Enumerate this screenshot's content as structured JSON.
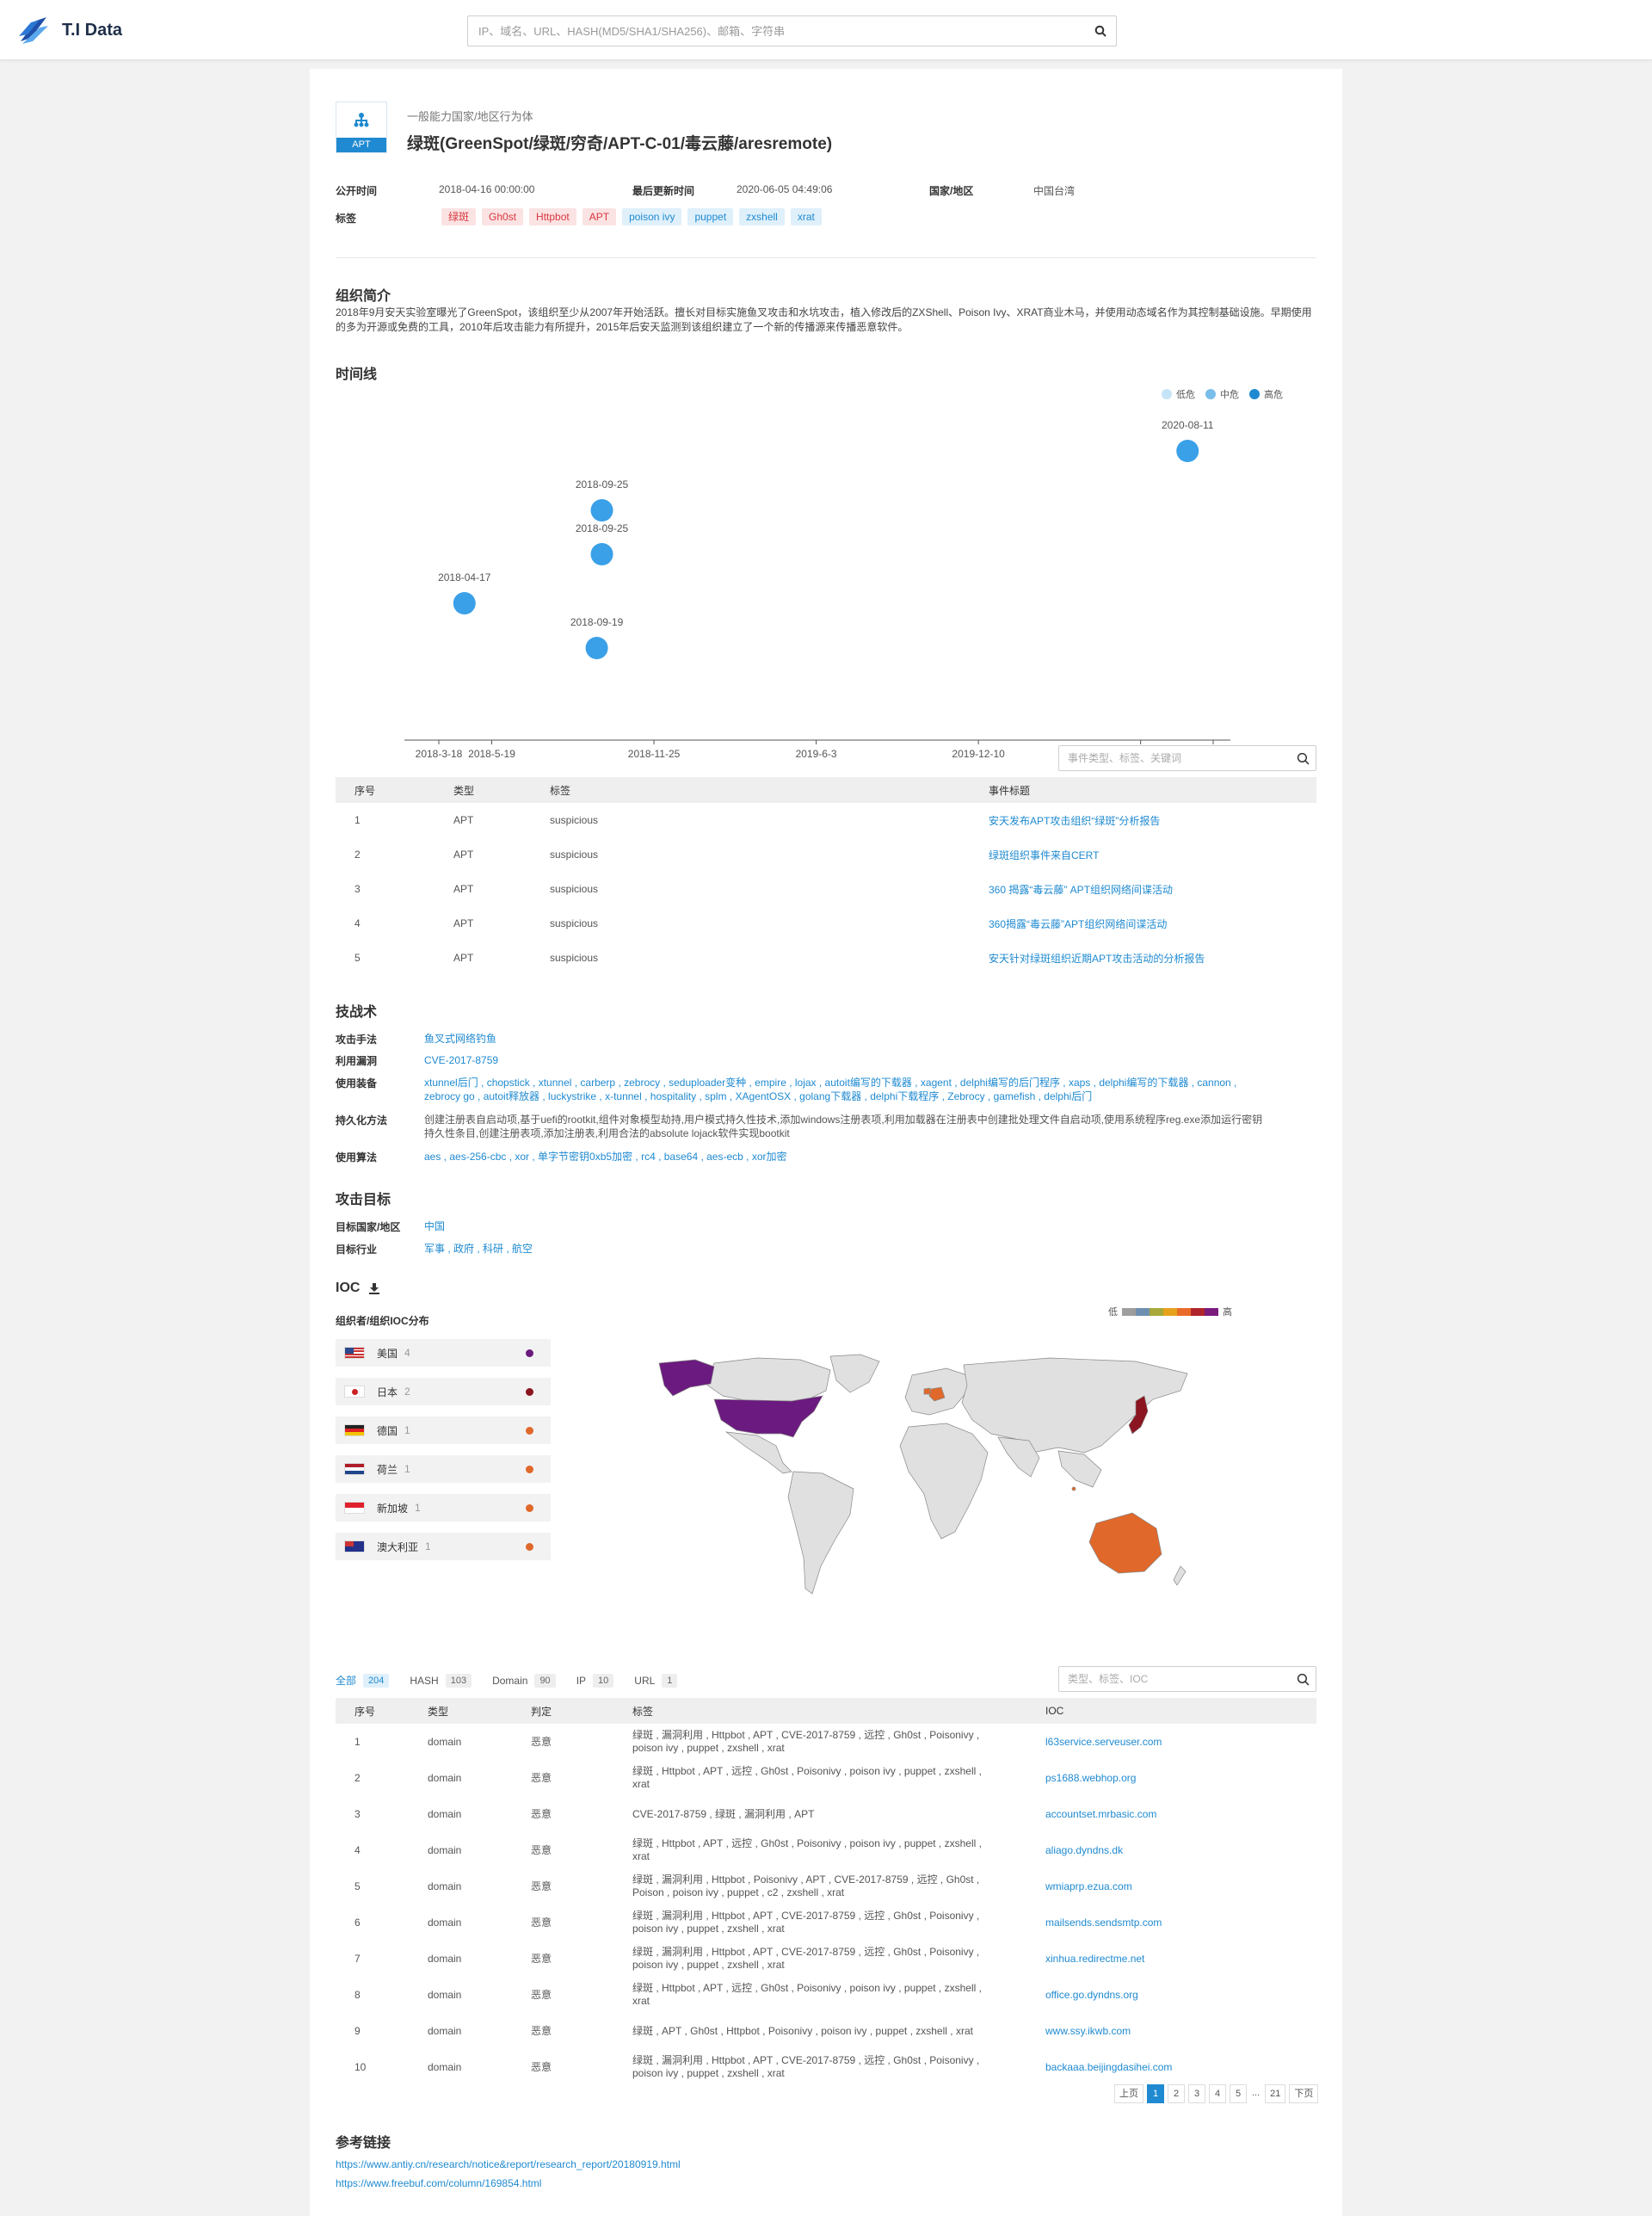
{
  "app": {
    "name": "T.I Data"
  },
  "search": {
    "placeholder": "IP、域名、URL、HASH(MD5/SHA1/SHA256)、邮箱、字符串"
  },
  "header": {
    "badge": "APT",
    "subtitle": "一般能力国家/地区行为体",
    "title": "绿斑(GreenSpot/绿斑/穷奇/APT-C-01/毒云藤/aresremote)"
  },
  "meta": {
    "published_label": "公开时间",
    "published": "2018-04-16 00:00:00",
    "updated_label": "最后更新时间",
    "updated": "2020-06-05 04:49:06",
    "country_label": "国家/地区",
    "country": "中国台湾",
    "tags_label": "标签",
    "tags": [
      {
        "text": "绿斑",
        "kind": "red"
      },
      {
        "text": "Gh0st",
        "kind": "red"
      },
      {
        "text": "Httpbot",
        "kind": "red"
      },
      {
        "text": "APT",
        "kind": "red"
      },
      {
        "text": "poison ivy",
        "kind": "blue"
      },
      {
        "text": "puppet",
        "kind": "blue"
      },
      {
        "text": "zxshell",
        "kind": "blue"
      },
      {
        "text": "xrat",
        "kind": "blue"
      }
    ]
  },
  "intro": {
    "title": "组织简介",
    "text": "2018年9月安天实验室曝光了GreenSpot，该组织至少从2007年开始活跃。擅长对目标实施鱼叉攻击和水坑攻击，植入修改后的ZXShell、Poison Ivy、XRAT商业木马，并使用动态域名作为其控制基础设施。早期使用的多为开源或免费的工具，2010年后攻击能力有所提升，2015年后安天监测到该组织建立了一个新的传播源来传播恶意软件。"
  },
  "timeline": {
    "title": "时间线",
    "legend": [
      {
        "label": "低危",
        "color": "#c6e4f7"
      },
      {
        "label": "中危",
        "color": "#79bdea"
      },
      {
        "label": "高危",
        "color": "#1f8ad1"
      }
    ]
  },
  "chart_data": {
    "type": "scatter",
    "x_ticks": [
      "2018-3-18",
      "2018-5-19",
      "2018-11-25",
      "2019-6-3",
      "2019-12-10",
      "2020-6-17",
      "2020-9-10"
    ],
    "points": [
      {
        "date": "2018-04-17",
        "label": "2018-04-17",
        "level": "高危"
      },
      {
        "date": "2018-09-25",
        "label": "2018-09-25",
        "level": "高危"
      },
      {
        "date": "2018-09-25",
        "label": "2018-09-25",
        "level": "高危"
      },
      {
        "date": "2018-09-19",
        "label": "2018-09-19",
        "level": "高危"
      },
      {
        "date": "2020-08-11",
        "label": "2020-08-11",
        "level": "高危"
      }
    ],
    "colors": {
      "高危": "#3aa0e8"
    }
  },
  "events": {
    "search_placeholder": "事件类型、标签、关键词",
    "columns": [
      "序号",
      "类型",
      "标签",
      "事件标题"
    ],
    "rows": [
      {
        "no": "1",
        "type": "APT",
        "tag": "suspicious",
        "title": "安天发布APT攻击组织“绿斑”分析报告"
      },
      {
        "no": "2",
        "type": "APT",
        "tag": "suspicious",
        "title": "绿斑组织事件来自CERT"
      },
      {
        "no": "3",
        "type": "APT",
        "tag": "suspicious",
        "title": "360 揭露“毒云藤” APT组织网络间谍活动"
      },
      {
        "no": "4",
        "type": "APT",
        "tag": "suspicious",
        "title": "360揭露“毒云藤”APT组织网络间谍活动"
      },
      {
        "no": "5",
        "type": "APT",
        "tag": "suspicious",
        "title": "安天针对绿斑组织近期APT攻击活动的分析报告"
      }
    ]
  },
  "tactics": {
    "title": "技战术",
    "attack_label": "攻击手法",
    "attack": "鱼叉式网络钓鱼",
    "vuln_label": "利用漏洞",
    "vuln": "CVE-2017-8759",
    "tools_label": "使用装备",
    "tools": "xtunnel后门 , chopstick , xtunnel , carberp , zebrocy , seduploader变种 , empire , lojax , autoit编写的下载器 , xagent , delphi编写的后门程序 , xaps , delphi编写的下载器 , cannon , zebrocy go , autoit释放器 , luckystrike , x-tunnel , hospitality , splm , XAgentOSX , golang下载器 , delphi下载程序 , Zebrocy , gamefish , delphi后门",
    "persist_label": "持久化方法",
    "persist": "创建注册表自启动项,基于uefi的rootkit,组件对象模型劫持,用户模式持久性技术,添加windows注册表项,利用加载器在注册表中创建批处理文件自启动项,使用系统程序reg.exe添加运行密钥持久性条目,创建注册表项,添加注册表,利用合法的absolute lojack软件实现bootkit",
    "algo_label": "使用算法",
    "algo": "aes , aes-256-cbc , xor , 单字节密钥0xb5加密 , rc4 , base64 , aes-ecb , xor加密"
  },
  "targets": {
    "title": "攻击目标",
    "country_label": "目标国家/地区",
    "country": "中国",
    "industry_label": "目标行业",
    "industry": "军事 , 政府 , 科研 , 航空"
  },
  "ioc": {
    "title": "IOC",
    "dist_title": "组织者/组织IOC分布",
    "scale_low": "低",
    "scale_high": "高",
    "scale_colors": [
      "#9e9e9e",
      "#6e8fb0",
      "#a7a93a",
      "#e6a21c",
      "#e96b2a",
      "#b0252c",
      "#7a1b7e"
    ],
    "countries": [
      {
        "name": "美国",
        "count": "4",
        "color": "#6b1a7f",
        "flag": "us"
      },
      {
        "name": "日本",
        "count": "2",
        "color": "#8b1520",
        "flag": "jp"
      },
      {
        "name": "德国",
        "count": "1",
        "color": "#e0682a",
        "flag": "de"
      },
      {
        "name": "荷兰",
        "count": "1",
        "color": "#e0682a",
        "flag": "nl"
      },
      {
        "name": "新加坡",
        "count": "1",
        "color": "#e0682a",
        "flag": "sg"
      },
      {
        "name": "澳大利亚",
        "count": "1",
        "color": "#e0682a",
        "flag": "au"
      }
    ],
    "tabs": [
      {
        "label": "全部",
        "count": "204",
        "active": true
      },
      {
        "label": "HASH",
        "count": "103"
      },
      {
        "label": "Domain",
        "count": "90"
      },
      {
        "label": "IP",
        "count": "10"
      },
      {
        "label": "URL",
        "count": "1"
      }
    ],
    "search_placeholder": "类型、标签、IOC",
    "columns": [
      "序号",
      "类型",
      "判定",
      "标签",
      "IOC"
    ],
    "rows": [
      {
        "no": "1",
        "type": "domain",
        "verdict": "恶意",
        "tags": "绿斑 , 漏洞利用 , Httpbot , APT , CVE-2017-8759 , 远控 , Gh0st , Poisonivy , poison ivy , puppet , zxshell , xrat",
        "ioc": "l63service.serveuser.com"
      },
      {
        "no": "2",
        "type": "domain",
        "verdict": "恶意",
        "tags": "绿斑 , Httpbot , APT , 远控 , Gh0st , Poisonivy , poison ivy , puppet , zxshell , xrat",
        "ioc": "ps1688.webhop.org"
      },
      {
        "no": "3",
        "type": "domain",
        "verdict": "恶意",
        "tags": "CVE-2017-8759 , 绿斑 , 漏洞利用 , APT",
        "ioc": "accountset.mrbasic.com"
      },
      {
        "no": "4",
        "type": "domain",
        "verdict": "恶意",
        "tags": "绿斑 , Httpbot , APT , 远控 , Gh0st , Poisonivy , poison ivy , puppet , zxshell , xrat",
        "ioc": "aliago.dyndns.dk"
      },
      {
        "no": "5",
        "type": "domain",
        "verdict": "恶意",
        "tags": "绿斑 , 漏洞利用 , Httpbot , Poisonivy , APT , CVE-2017-8759 , 远控 , Gh0st , Poison , poison ivy , puppet , c2 , zxshell , xrat",
        "ioc": "wmiaprp.ezua.com"
      },
      {
        "no": "6",
        "type": "domain",
        "verdict": "恶意",
        "tags": "绿斑 , 漏洞利用 , Httpbot , APT , CVE-2017-8759 , 远控 , Gh0st , Poisonivy , poison ivy , puppet , zxshell , xrat",
        "ioc": "mailsends.sendsmtp.com"
      },
      {
        "no": "7",
        "type": "domain",
        "verdict": "恶意",
        "tags": "绿斑 , 漏洞利用 , Httpbot , APT , CVE-2017-8759 , 远控 , Gh0st , Poisonivy , poison ivy , puppet , zxshell , xrat",
        "ioc": "xinhua.redirectme.net"
      },
      {
        "no": "8",
        "type": "domain",
        "verdict": "恶意",
        "tags": "绿斑 , Httpbot , APT , 远控 , Gh0st , Poisonivy , poison ivy , puppet , zxshell , xrat",
        "ioc": "office.go.dyndns.org"
      },
      {
        "no": "9",
        "type": "domain",
        "verdict": "恶意",
        "tags": "绿斑 , APT , Gh0st , Httpbot , Poisonivy , poison ivy , puppet , zxshell , xrat",
        "ioc": "www.ssy.ikwb.com"
      },
      {
        "no": "10",
        "type": "domain",
        "verdict": "恶意",
        "tags": "绿斑 , 漏洞利用 , Httpbot , APT , CVE-2017-8759 , 远控 , Gh0st , Poisonivy , poison ivy , puppet , zxshell , xrat",
        "ioc": "backaaa.beijingdasihei.com"
      }
    ],
    "pager": {
      "prev": "上页",
      "pages": [
        "1",
        "2",
        "3",
        "4",
        "5"
      ],
      "ellipsis": "...",
      "last": "21",
      "next": "下页"
    }
  },
  "refs": {
    "title": "参考链接",
    "links": [
      "https://www.antiy.cn/research/notice&report/research_report/20180919.html",
      "https://www.freebuf.com/column/169854.html"
    ]
  }
}
